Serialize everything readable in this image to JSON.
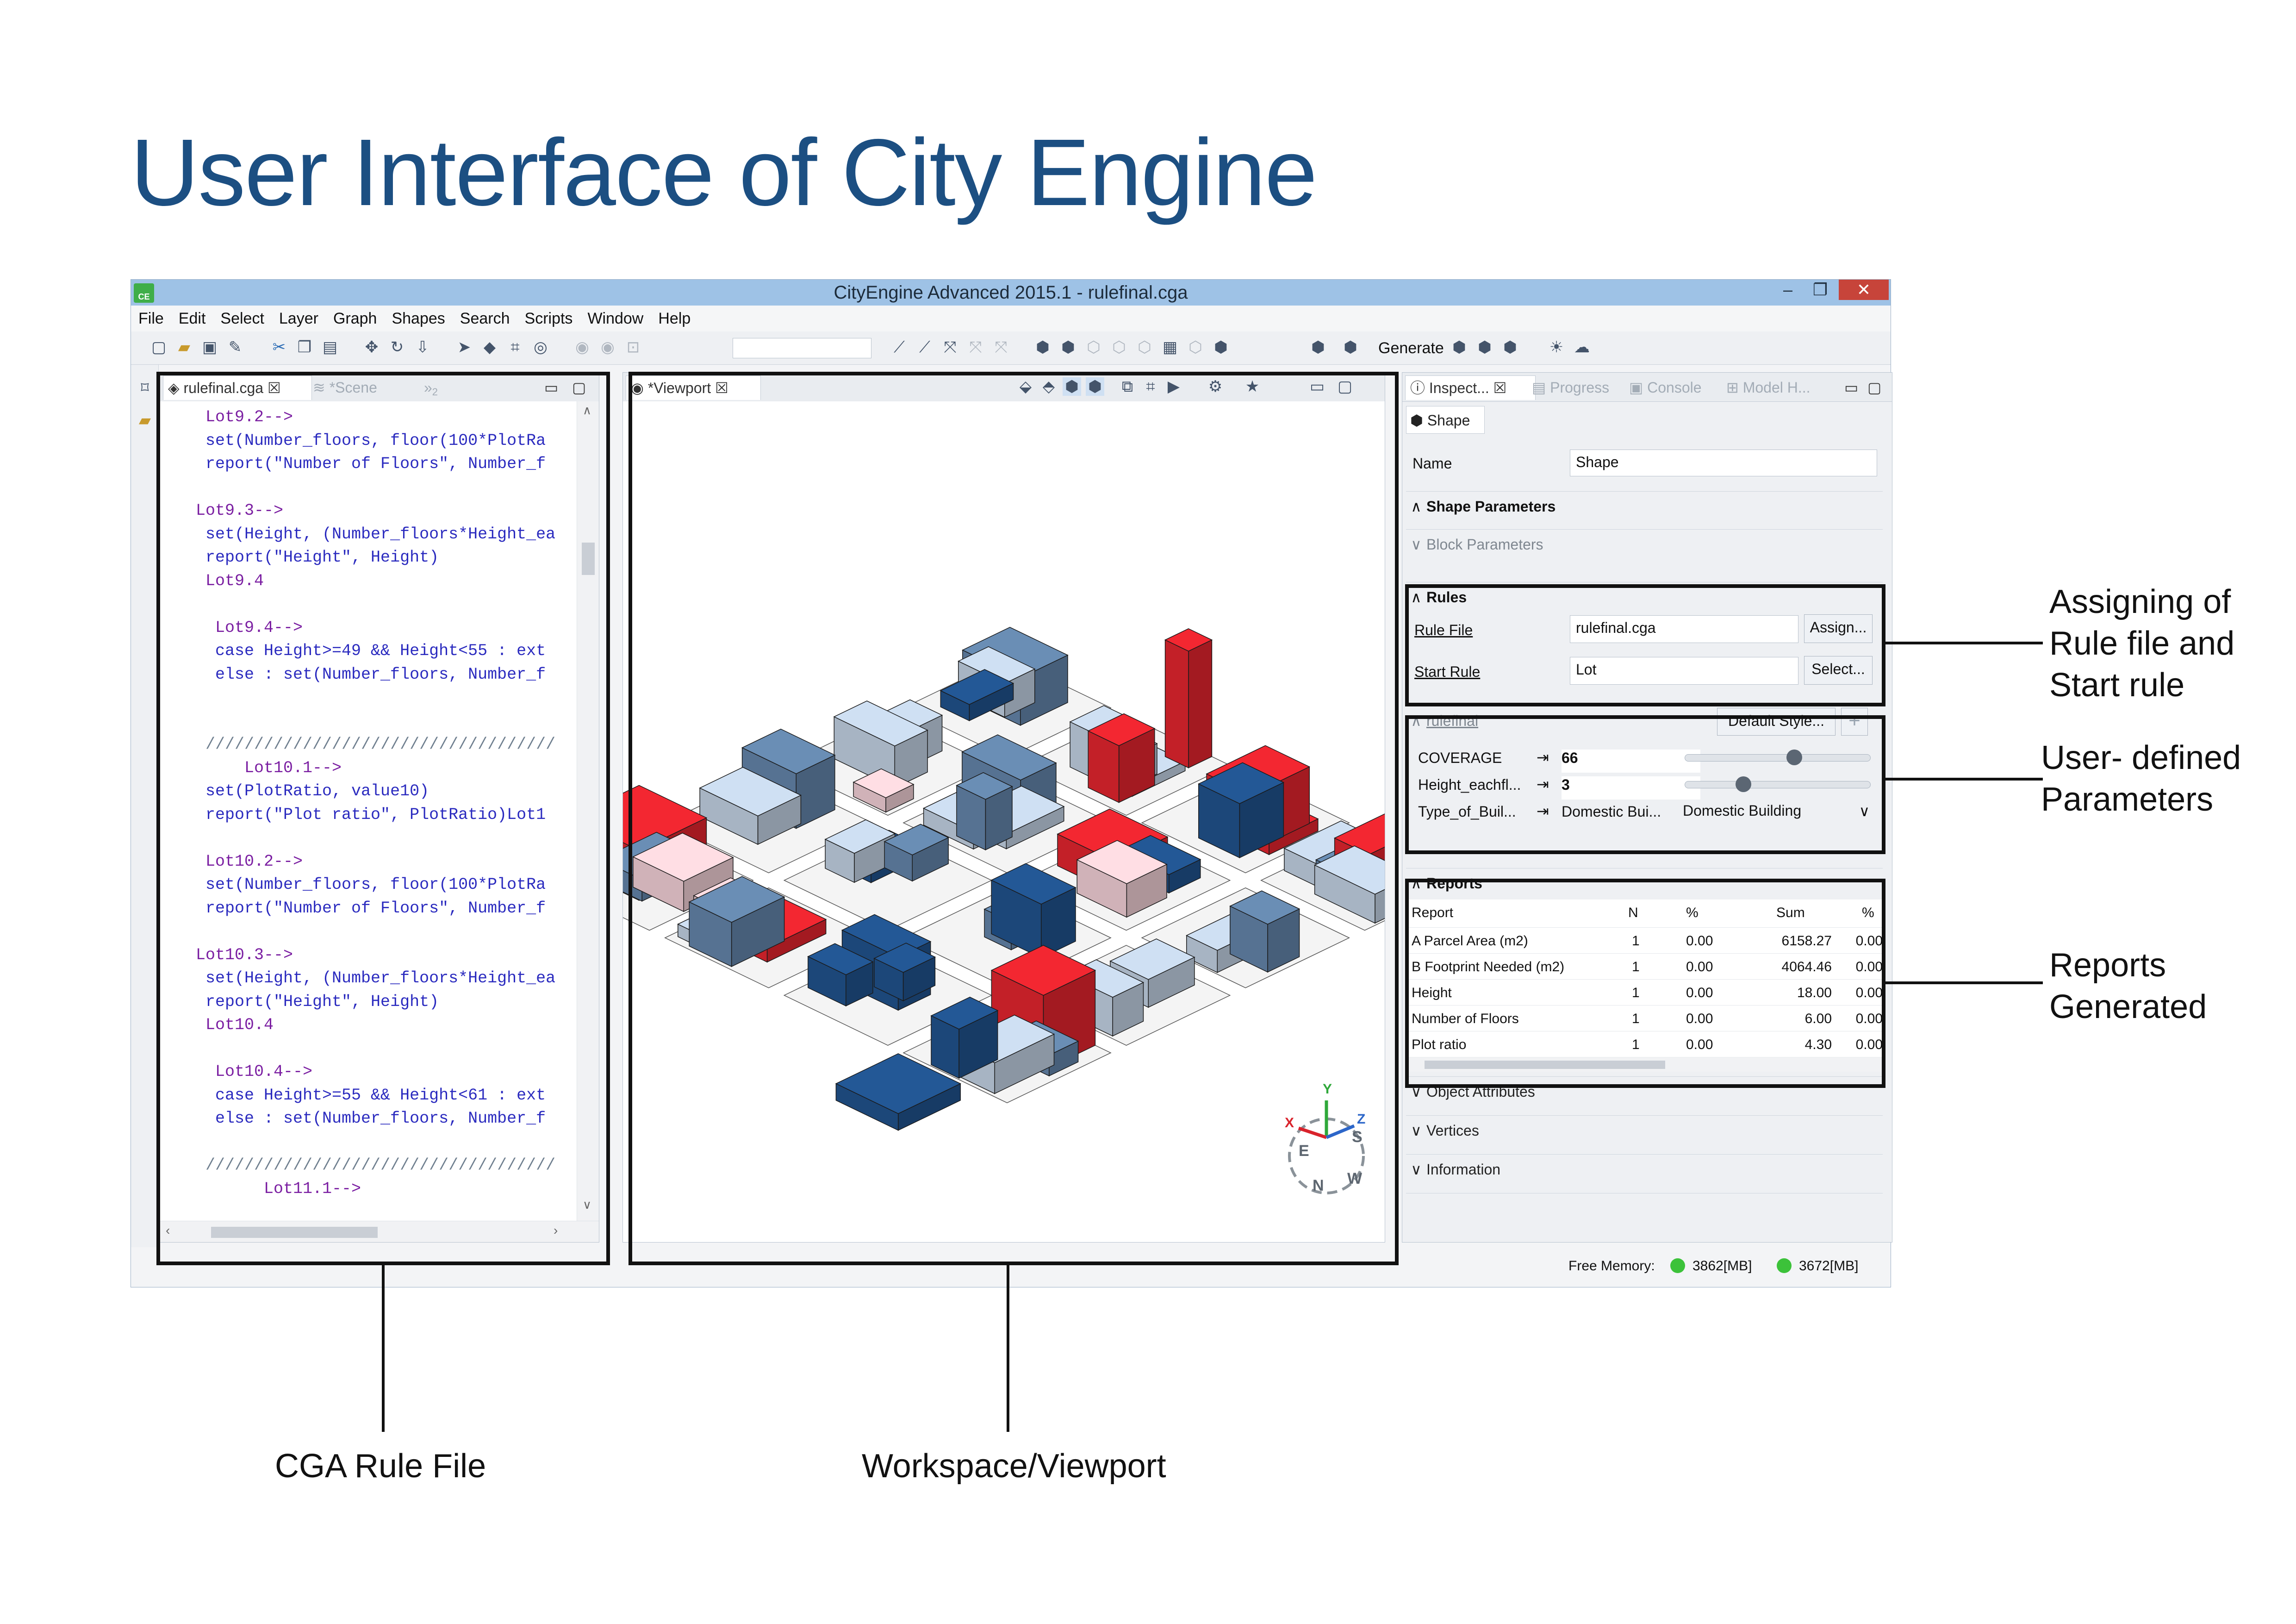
{
  "slide": {
    "title": "User Interface of City Engine"
  },
  "window": {
    "title": "CityEngine Advanced 2015.1 - rulefinal.cga",
    "app_icon_text": "CE",
    "min_glyph": "–",
    "max_glyph": "❐",
    "close_glyph": "✕"
  },
  "menubar": [
    "File",
    "Edit",
    "Select",
    "Layer",
    "Graph",
    "Shapes",
    "Search",
    "Scripts",
    "Window",
    "Help"
  ],
  "toolbar": {
    "generate_label": "Generate"
  },
  "code_editor": {
    "tabs": {
      "active": "rulefinal.cga",
      "scene": "*Scene",
      "overflow": "»",
      "overflow_count": "2"
    },
    "lines": [
      {
        "indent": 2,
        "kind": "rule",
        "text": "Lot9.2-->"
      },
      {
        "indent": 2,
        "kind": "set",
        "text": "set(Number_floors, floor(100*PlotRa"
      },
      {
        "indent": 2,
        "kind": "set",
        "text": "report(\"Number of Floors\", Number_f"
      },
      {
        "indent": 0,
        "kind": "blank",
        "text": ""
      },
      {
        "indent": 1,
        "kind": "rule",
        "text": "Lot9.3-->"
      },
      {
        "indent": 1,
        "kind": "set",
        "text": " set(Height, (Number_floors*Height_ea"
      },
      {
        "indent": 2,
        "kind": "set",
        "text": "report(\"Height\", Height)"
      },
      {
        "indent": 2,
        "kind": "rule",
        "text": "Lot9.4"
      },
      {
        "indent": 0,
        "kind": "blank",
        "text": ""
      },
      {
        "indent": 3,
        "kind": "rule",
        "text": "Lot9.4-->"
      },
      {
        "indent": 3,
        "kind": "set",
        "text": "case Height>=49 && Height<55 : ext"
      },
      {
        "indent": 3,
        "kind": "set",
        "text": "else : set(Number_floors, Number_f"
      },
      {
        "indent": 0,
        "kind": "blank",
        "text": ""
      },
      {
        "indent": 0,
        "kind": "blank",
        "text": ""
      },
      {
        "indent": 1,
        "kind": "sep",
        "text": " ////////////////////////////////////"
      },
      {
        "indent": 6,
        "kind": "rule",
        "text": "Lot10.1-->"
      },
      {
        "indent": 2,
        "kind": "set",
        "text": "set(PlotRatio, value10)"
      },
      {
        "indent": 2,
        "kind": "set",
        "text": "report(\"Plot ratio\", PlotRatio)Lot1"
      },
      {
        "indent": 0,
        "kind": "blank",
        "text": ""
      },
      {
        "indent": 2,
        "kind": "rule",
        "text": "Lot10.2-->"
      },
      {
        "indent": 2,
        "kind": "set",
        "text": "set(Number_floors, floor(100*PlotRa"
      },
      {
        "indent": 2,
        "kind": "set",
        "text": "report(\"Number of Floors\", Number_f"
      },
      {
        "indent": 0,
        "kind": "blank",
        "text": ""
      },
      {
        "indent": 1,
        "kind": "rule",
        "text": "Lot10.3-->"
      },
      {
        "indent": 1,
        "kind": "set",
        "text": " set(Height, (Number_floors*Height_ea"
      },
      {
        "indent": 2,
        "kind": "set",
        "text": "report(\"Height\", Height)"
      },
      {
        "indent": 2,
        "kind": "rule",
        "text": "Lot10.4"
      },
      {
        "indent": 0,
        "kind": "blank",
        "text": ""
      },
      {
        "indent": 3,
        "kind": "rule",
        "text": "Lot10.4-->"
      },
      {
        "indent": 3,
        "kind": "set",
        "text": "case Height>=55 && Height<61 : ext"
      },
      {
        "indent": 3,
        "kind": "set",
        "text": "else : set(Number_floors, Number_f"
      },
      {
        "indent": 0,
        "kind": "blank",
        "text": ""
      },
      {
        "indent": 1,
        "kind": "sep",
        "text": " ////////////////////////////////////"
      },
      {
        "indent": 8,
        "kind": "rule",
        "text": "Lot11.1-->"
      }
    ]
  },
  "viewport": {
    "tab": "*Viewport",
    "axes": {
      "y": "Y",
      "x": "X",
      "z": "Z"
    },
    "compass": [
      "E",
      "S",
      "W",
      "N"
    ],
    "colors": {
      "blue_dark": "#1f4f86",
      "blue_mid": "#5f7fa2",
      "blue_light": "#b9c8d9",
      "pink": "#e7c6cc",
      "red": "#d9232c"
    }
  },
  "inspector": {
    "tabs": [
      "Inspect...",
      "Progress",
      "Console",
      "Model H..."
    ],
    "shape_tab": "Shape",
    "name_label": "Name",
    "name_value": "Shape",
    "shape_parameters": "Shape Parameters",
    "block_parameters": "Block Parameters",
    "rules": {
      "heading": "Rules",
      "rule_file_label": "Rule File",
      "rule_file_value": "rulefinal.cga",
      "assign_button": "Assign...",
      "start_rule_label": "Start Rule",
      "start_rule_value": "Lot",
      "select_button": "Select..."
    },
    "rulefinal": {
      "heading": "rulefinal",
      "style_button": "Default Style...",
      "add_glyph": "+",
      "params": [
        {
          "label": "COVERAGE",
          "value": "66",
          "slider": 0.6
        },
        {
          "label": "Height_eachfl...",
          "value": "3",
          "slider": 0.3
        },
        {
          "label": "Type_of_Buil...",
          "value": "Domestic Bui...",
          "select": "Domestic Building"
        }
      ]
    },
    "reports": {
      "heading": "Reports",
      "columns": [
        "Report",
        "N",
        "%",
        "Sum",
        "%"
      ],
      "rows": [
        [
          "A Parcel Area (m2)",
          "1",
          "0.00",
          "6158.27",
          "0.00"
        ],
        [
          "B Footprint Needed (m2)",
          "1",
          "0.00",
          "4064.46",
          "0.00"
        ],
        [
          "Height",
          "1",
          "0.00",
          "18.00",
          "0.00"
        ],
        [
          "Number of Floors",
          "1",
          "0.00",
          "6.00",
          "0.00"
        ],
        [
          "Plot ratio",
          "1",
          "0.00",
          "4.30",
          "0.00"
        ]
      ]
    },
    "collapsed_sections": [
      "Object Attributes",
      "Vertices",
      "Information"
    ]
  },
  "statusbar": {
    "free_memory_label": "Free Memory:",
    "mem1": "3862[MB]",
    "mem2": "3672[MB]"
  },
  "annotations": {
    "rules": "Assigning of\nRule file and\nStart rule",
    "params": "User- defined\nParameters",
    "reports": "Reports\nGenerated",
    "cga": "CGA Rule File",
    "viewport": "Workspace/Viewport"
  }
}
